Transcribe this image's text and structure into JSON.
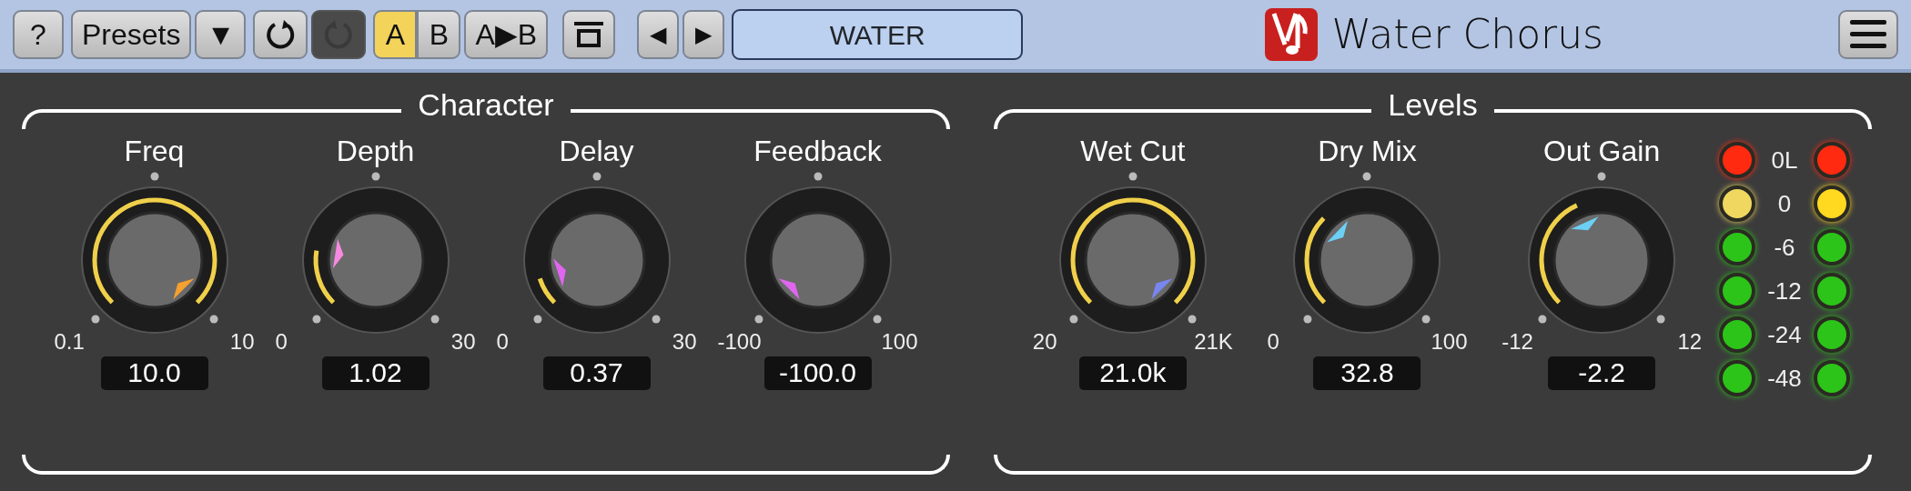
{
  "toolbar": {
    "help_button": "?",
    "presets_button": "Presets",
    "presets_menu": "▼",
    "undo": {
      "disabled": false
    },
    "redo": {
      "disabled": true
    },
    "ab": [
      {
        "label": "A",
        "selected": true
      },
      {
        "label": "B",
        "selected": false
      }
    ],
    "copy_button": "A▶B",
    "prev_button": "◀",
    "next_button": "▶",
    "preset_name": "WATER",
    "title": "Water Chorus"
  },
  "sections": [
    {
      "title": "Character",
      "knobs": [
        {
          "label": "Freq",
          "min": "0.1",
          "max": "10",
          "value": "10.0",
          "color": "#f5a030"
        },
        {
          "label": "Depth",
          "min": "0",
          "max": "30",
          "value": "1.02",
          "color": "#f58ae0"
        },
        {
          "label": "Delay",
          "min": "0",
          "max": "30",
          "value": "0.37",
          "color": "#e066f0"
        },
        {
          "label": "Feedback",
          "min": "-100",
          "max": "100",
          "value": "-100.0",
          "color": "#e066f0"
        }
      ]
    },
    {
      "title": "Levels",
      "knobs": [
        {
          "label": "Wet Cut",
          "min": "20",
          "max": "21K",
          "value": "21.0k",
          "color": "#7a86f0"
        },
        {
          "label": "Dry Mix",
          "min": "0",
          "max": "100",
          "value": "32.8",
          "color": "#6cd0f5"
        },
        {
          "label": "Out Gain",
          "min": "-12",
          "max": "12",
          "value": "-2.2",
          "color": "#6cd0f5"
        }
      ],
      "meter": [
        {
          "label": "0L",
          "left": {
            "color": "#ff2a10"
          },
          "right": {
            "color": "#ff2a10"
          }
        },
        {
          "label": "0",
          "left": {
            "color": "#f0d860"
          },
          "right": {
            "color": "#ffd820"
          }
        },
        {
          "label": "-6",
          "left": {
            "color": "#2cc418"
          },
          "right": {
            "color": "#2cc418"
          }
        },
        {
          "label": "-12",
          "left": {
            "color": "#2cc418"
          },
          "right": {
            "color": "#2cc418"
          }
        },
        {
          "label": "-24",
          "left": {
            "color": "#2cc418"
          },
          "right": {
            "color": "#2cc418"
          }
        },
        {
          "label": "-48",
          "left": {
            "color": "#2cc418"
          },
          "right": {
            "color": "#2cc418"
          }
        }
      ]
    }
  ]
}
